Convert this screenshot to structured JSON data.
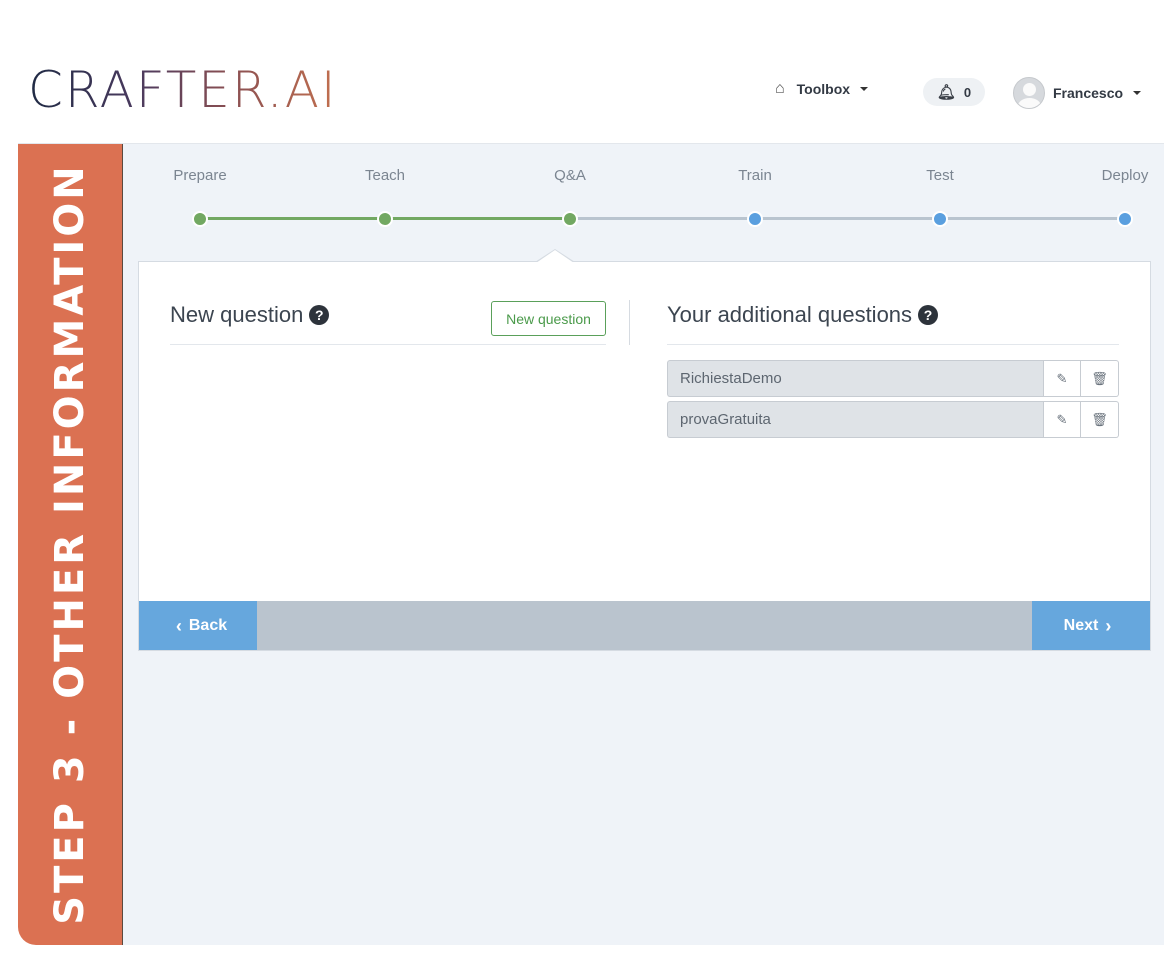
{
  "header": {
    "logo_text": "CRAFTER.AI",
    "toolbox_label": "Toolbox",
    "notifications_count": "0",
    "user_name": "Francesco"
  },
  "sidebar": {
    "title": "STEP 3 - OTHER INFORMATION",
    "color": "#db7152"
  },
  "stepper": {
    "steps": [
      {
        "label": "Prepare",
        "status": "completed"
      },
      {
        "label": "Teach",
        "status": "completed"
      },
      {
        "label": "Q&A",
        "status": "current"
      },
      {
        "label": "Train",
        "status": "pending"
      },
      {
        "label": "Test",
        "status": "pending"
      },
      {
        "label": "Deploy",
        "status": "pending"
      }
    ],
    "colors": {
      "completed": "#72a862",
      "pending": "#5a9fdf",
      "pending_line": "#b9c4cf"
    }
  },
  "new_question": {
    "title": "New question",
    "button_label": "New question"
  },
  "additional_questions": {
    "title": "Your additional questions",
    "items": [
      {
        "name": "RichiestaDemo"
      },
      {
        "name": "provaGratuita"
      }
    ]
  },
  "footer": {
    "back_label": "Back",
    "next_label": "Next"
  }
}
